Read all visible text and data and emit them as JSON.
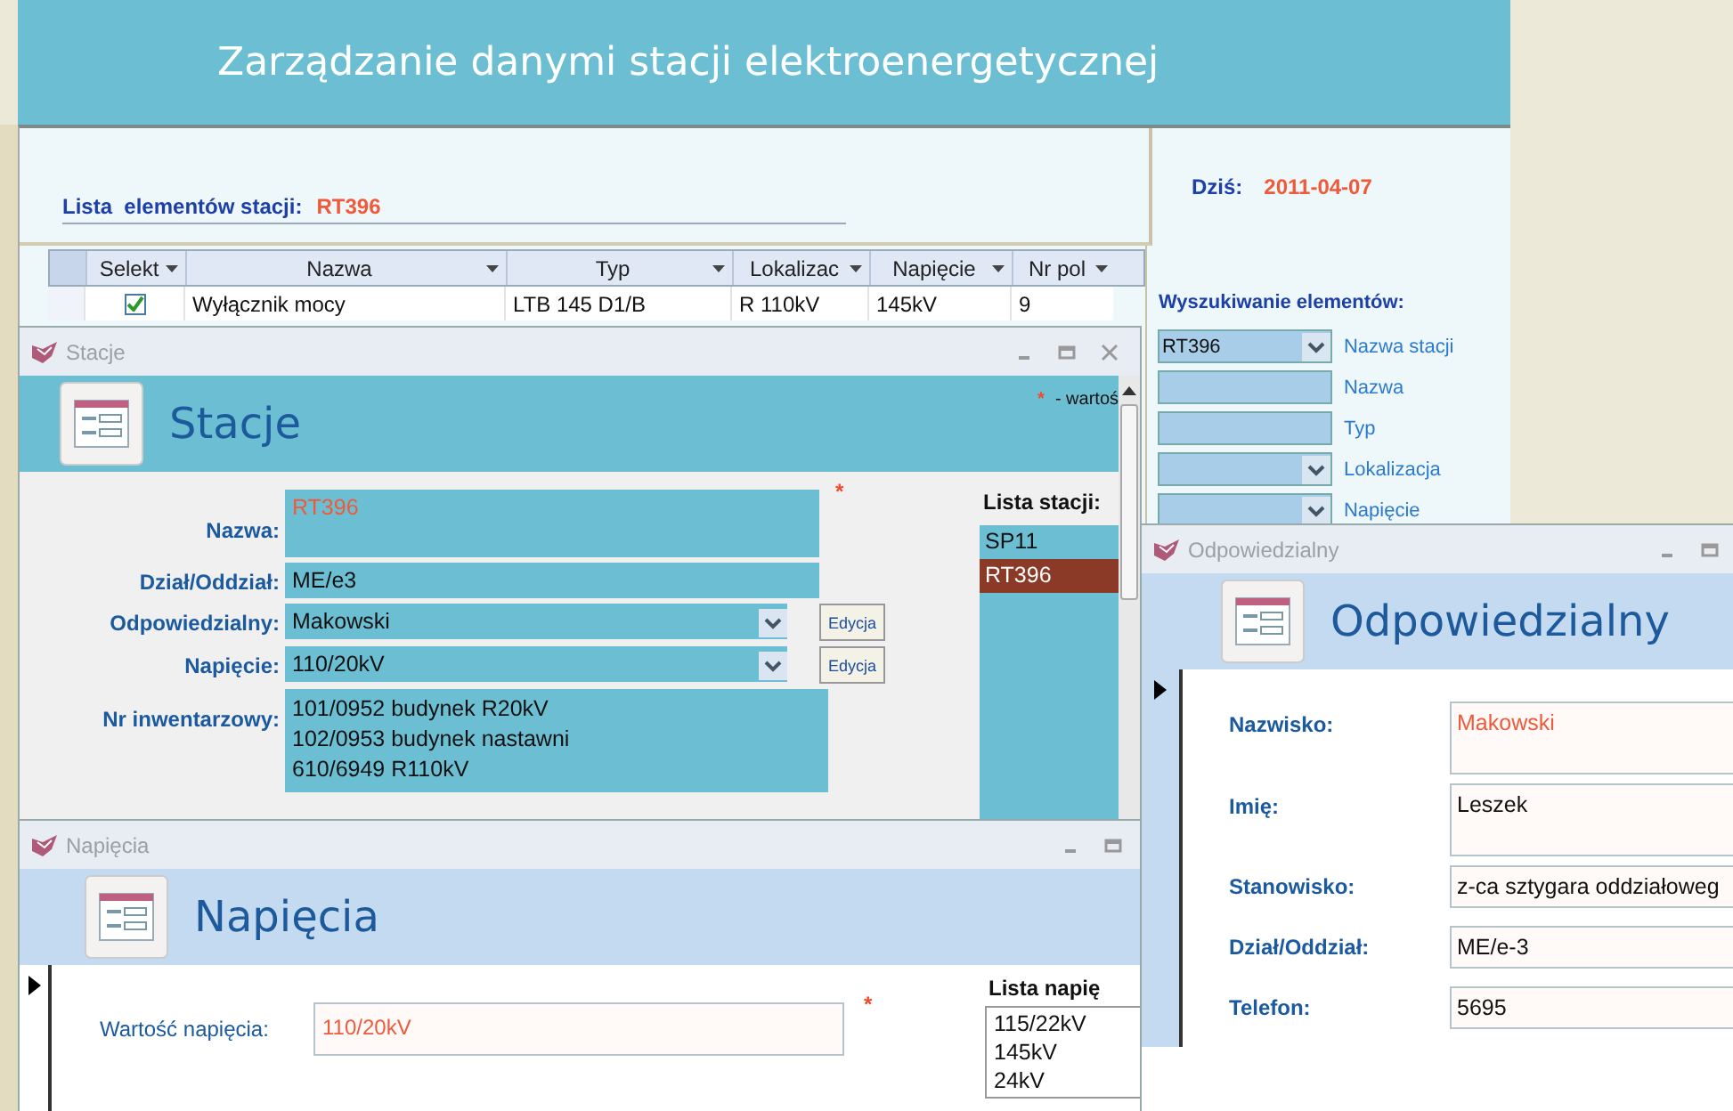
{
  "app": {
    "title": "Zarządzanie danymi stacji elektroenergetycznej",
    "list_label": "Lista  elementów stacji:",
    "list_station": "RT396",
    "today_label": "Dziś:",
    "today": "2011-04-07"
  },
  "table": {
    "columns": [
      "Selekt",
      "Nazwa",
      "Typ",
      "Lokalizac",
      "Napięcie",
      "Nr pol"
    ],
    "rows": [
      {
        "cells": [
          {
            "kind": "check",
            "checked": true
          },
          {
            "kind": "text",
            "text": "Wyłącznik mocy"
          },
          {
            "kind": "text",
            "text": "LTB 145 D1/B"
          },
          {
            "kind": "text",
            "text": "R 110kV"
          },
          {
            "kind": "text",
            "text": "145kV"
          },
          {
            "kind": "text",
            "text": "9"
          }
        ]
      }
    ]
  },
  "search": {
    "title": "Wyszukiwanie elementów:",
    "fields": [
      {
        "kind": "combo",
        "value": "RT396",
        "label": "Nazwa stacji"
      },
      {
        "kind": "text",
        "label": "Nazwa"
      },
      {
        "kind": "text",
        "label": "Typ"
      },
      {
        "kind": "combo",
        "label": "Lokalizacja"
      },
      {
        "kind": "combo",
        "label": "Napięcie"
      }
    ]
  },
  "stacje": {
    "title": "Stacje",
    "heading": "Stacje",
    "legend_mark": "*",
    "legend": "- wartoś",
    "list_title": "Lista stacji:",
    "fields": [
      {
        "kind": "tall",
        "label": "Nazwa:",
        "value": "RT396",
        "emphasis": true,
        "mark": "*"
      },
      {
        "kind": "text",
        "label": "Dział/Oddział:",
        "value": "ME/e3",
        "emphasis": false
      },
      {
        "kind": "combo",
        "label": "Odpowiedzialny:",
        "value": "Makowski",
        "emphasis": false,
        "button": "Edycja"
      },
      {
        "kind": "combo",
        "label": "Napięcie:",
        "value": "110/20kV",
        "emphasis": false,
        "button": "Edycja"
      },
      {
        "kind": "multi",
        "label": "Nr inwentarzowy:",
        "lines": [
          "101/0952 budynek R20kV",
          "102/0953 budynek nastawni",
          "610/6949 R110kV"
        ],
        "emphasis": false
      }
    ],
    "list": [
      {
        "label": "SP11",
        "selected": false
      },
      {
        "label": "RT396",
        "selected": true
      }
    ]
  },
  "napiecia": {
    "title": "Napięcia",
    "heading": "Napięcia",
    "list_title": "Lista napię",
    "fields": [
      {
        "label": "Wartość napięcia:",
        "value": "110/20kV",
        "emphasis": true,
        "mark": "*"
      }
    ],
    "list": [
      {
        "label": "115/22kV",
        "selected": false
      },
      {
        "label": "145kV",
        "selected": false
      },
      {
        "label": "24kV",
        "selected": false
      }
    ]
  },
  "odpowiedzialny": {
    "title": "Odpowiedzialny",
    "heading": "Odpowiedzialny",
    "fields": [
      {
        "kind": "tall",
        "label": "Nazwisko:",
        "value": "Makowski",
        "emphasis": true
      },
      {
        "kind": "tall",
        "label": "Imię:",
        "value": "Leszek",
        "emphasis": false
      },
      {
        "kind": "text",
        "label": "Stanowisko:",
        "value": "z-ca sztygara oddziałoweg",
        "emphasis": false
      },
      {
        "kind": "text",
        "label": "Dział/Oddział:",
        "value": "ME/e-3",
        "emphasis": false
      },
      {
        "kind": "text",
        "label": "Telefon:",
        "value": "5695",
        "emphasis": false
      }
    ]
  }
}
